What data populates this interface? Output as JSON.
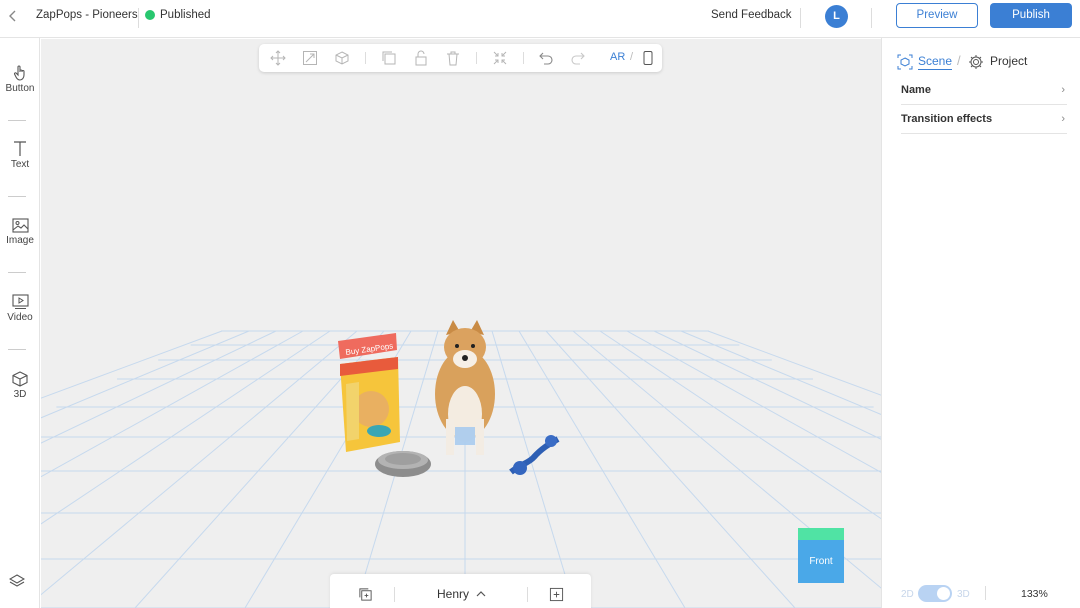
{
  "header": {
    "project_title": "ZapPops - Pioneers",
    "status": "Published",
    "status_color": "#28c76f",
    "feedback_label": "Send Feedback",
    "avatar_initial": "L",
    "preview_label": "Preview",
    "publish_label": "Publish",
    "accent_color": "#3b7fd4"
  },
  "left_toolbar": {
    "tools": [
      {
        "label": "Button",
        "icon": "hand-pointer-icon"
      },
      {
        "label": "Text",
        "icon": "text-icon"
      },
      {
        "label": "Image",
        "icon": "image-icon"
      },
      {
        "label": "Video",
        "icon": "video-icon"
      },
      {
        "label": "3D",
        "icon": "cube-icon"
      }
    ],
    "bottom_icon": "layers-icon"
  },
  "canvas_toolbar": {
    "icons": [
      "move-icon",
      "scale-icon",
      "rotate-icon",
      "duplicate-icon",
      "unlock-icon",
      "delete-icon",
      "collapse-icon",
      "undo-icon",
      "redo-icon"
    ],
    "ar_label": "AR",
    "separator": "/",
    "view_icon": "phone-icon"
  },
  "scene": {
    "buy_button_label": "Buy ZapPops",
    "front_label": "Front",
    "scene_name": "Henry"
  },
  "right_panel": {
    "tab_scene": "Scene",
    "tab_separator": "/",
    "tab_project": "Project",
    "rows": [
      "Name",
      "Transition effects"
    ],
    "toggle_2d": "2D",
    "toggle_3d": "3D",
    "toggle_value": "3D",
    "zoom": "133%"
  }
}
